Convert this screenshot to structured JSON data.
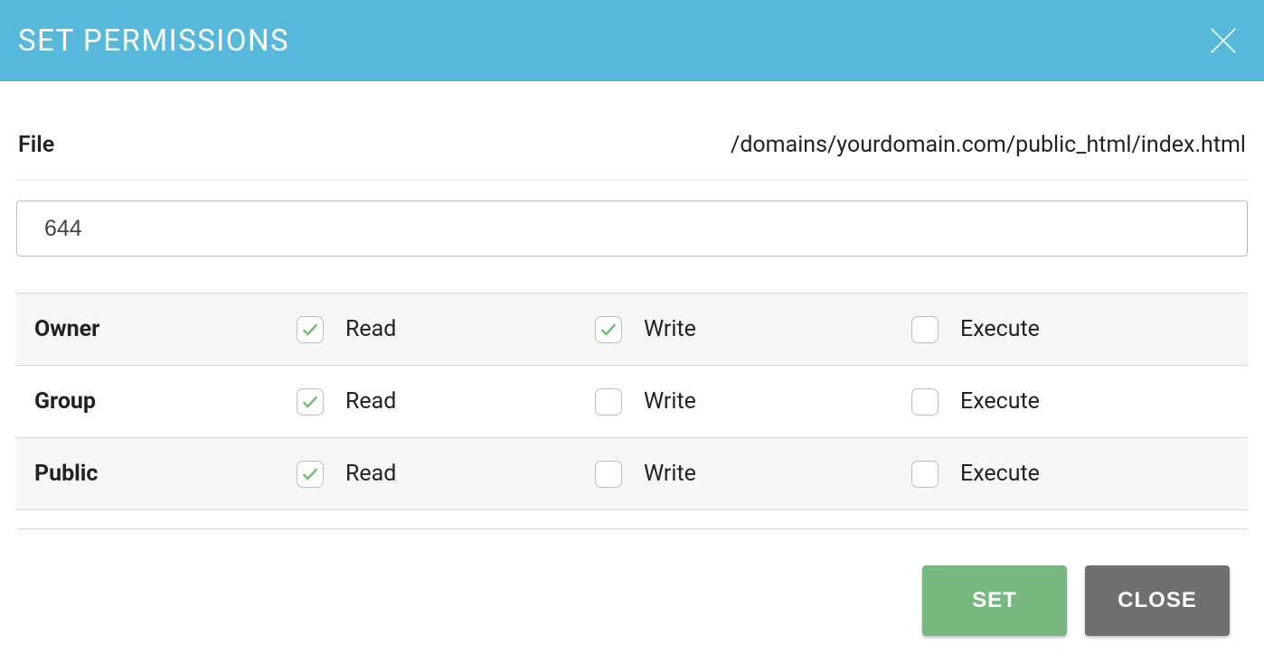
{
  "header": {
    "title": "SET PERMISSIONS"
  },
  "file": {
    "label": "File",
    "path": "/domains/yourdomain.com/public_html/index.html"
  },
  "permission_value": "644",
  "columns": {
    "read": "Read",
    "write": "Write",
    "execute": "Execute"
  },
  "roles": [
    {
      "key": "owner",
      "label": "Owner",
      "read": true,
      "write": true,
      "execute": false,
      "shaded": true
    },
    {
      "key": "group",
      "label": "Group",
      "read": true,
      "write": false,
      "execute": false,
      "shaded": false
    },
    {
      "key": "public",
      "label": "Public",
      "read": true,
      "write": false,
      "execute": false,
      "shaded": true
    }
  ],
  "buttons": {
    "set": "SET",
    "close": "CLOSE"
  }
}
